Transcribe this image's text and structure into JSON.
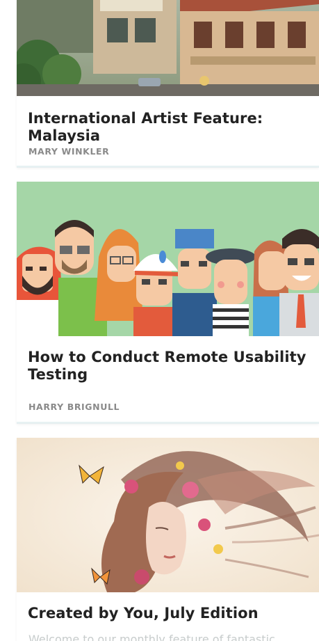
{
  "articles": [
    {
      "title": "International Artist Feature: Malaysia",
      "author": "MARY WINKLER",
      "image": "street-scene-illustration"
    },
    {
      "title": "How to Conduct Remote Usability Testing",
      "author": "HARRY BRIGNULL",
      "image": "crowd-of-people-illustration"
    },
    {
      "title": "Created by You, July Edition",
      "excerpt": "Welcome to our monthly feature of fantastic",
      "image": "woman-with-flowers-artwork"
    }
  ],
  "colors": {
    "title": "#222222",
    "author": "#8a8a8a",
    "excerpt": "#c7cccc",
    "card_border": "#e7f2f3",
    "people_background": "#a5d6a7"
  }
}
